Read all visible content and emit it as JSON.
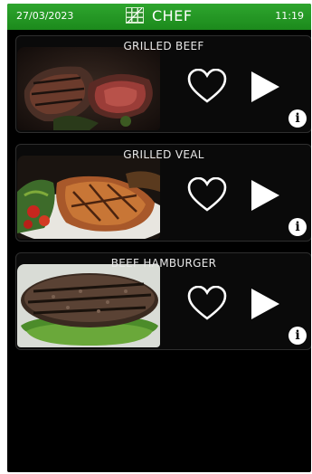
{
  "status_bar": {
    "date": "27/03/2023",
    "title": "CHEF",
    "time": "11:19",
    "logo_icon": "chef-grid-logo-icon",
    "color": "#229622"
  },
  "recipes": [
    {
      "name": "GRILLED BEEF",
      "image": "grilled-beef-photo"
    },
    {
      "name": "GRILLED VEAL",
      "image": "grilled-veal-photo"
    },
    {
      "name": "BEEF HAMBURGER",
      "image": "beef-hamburger-photo"
    }
  ],
  "icons": {
    "favorite": "heart-outline-icon",
    "play": "play-icon",
    "info": "info-icon"
  },
  "info_glyph": "i"
}
